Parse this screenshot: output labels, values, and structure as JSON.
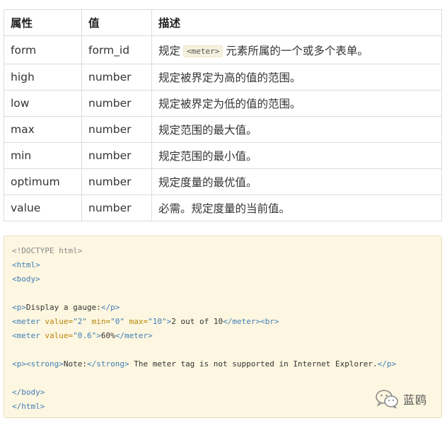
{
  "table": {
    "headers": [
      "属性",
      "值",
      "描述"
    ],
    "rows": [
      {
        "attr": "form",
        "value": "form_id",
        "desc_pre": "规定",
        "desc_code": "<meter>",
        "desc_post": "元素所属的一个或多个表单。"
      },
      {
        "attr": "high",
        "value": "number",
        "desc": "规定被界定为高的值的范围。"
      },
      {
        "attr": "low",
        "value": "number",
        "desc": "规定被界定为低的值的范围。"
      },
      {
        "attr": "max",
        "value": "number",
        "desc": "规定范围的最大值。"
      },
      {
        "attr": "min",
        "value": "number",
        "desc": "规定范围的最小值。"
      },
      {
        "attr": "optimum",
        "value": "number",
        "desc": "规定度量的最优值。"
      },
      {
        "attr": "value",
        "value": "number",
        "desc": "必需。规定度量的当前值。"
      }
    ]
  },
  "code": {
    "doctype": "<!DOCTYPE html>",
    "html_open": "<html>",
    "body_open": "<body>",
    "p_open": "<p>",
    "p_text": "Display a gauge:",
    "p_close": "</p>",
    "meter_open": "<meter",
    "attr_value": " value=",
    "attr_min": " min=",
    "attr_max": " max=",
    "str_2": "\"2\"",
    "str_0": "\"0\"",
    "str_10": "\"10\"",
    "str_06": "\"0.6\"",
    "gt": ">",
    "meter1_text": "2 out of 10",
    "meter_close": "</meter>",
    "br": "<br>",
    "meter2_text": "60%",
    "strong_open": "<strong>",
    "strong_text": "Note:",
    "strong_close": "</strong>",
    "note_text": " The meter tag is not supported in Internet Explorer.",
    "body_close": "</body>",
    "html_close": "</html>"
  },
  "watermark": {
    "label": "蓝鸥"
  },
  "colors": {
    "code_bg": "#fdf6e0",
    "tag": "#3f7fb8",
    "attr": "#b8860b",
    "border": "#dcdcdc"
  }
}
